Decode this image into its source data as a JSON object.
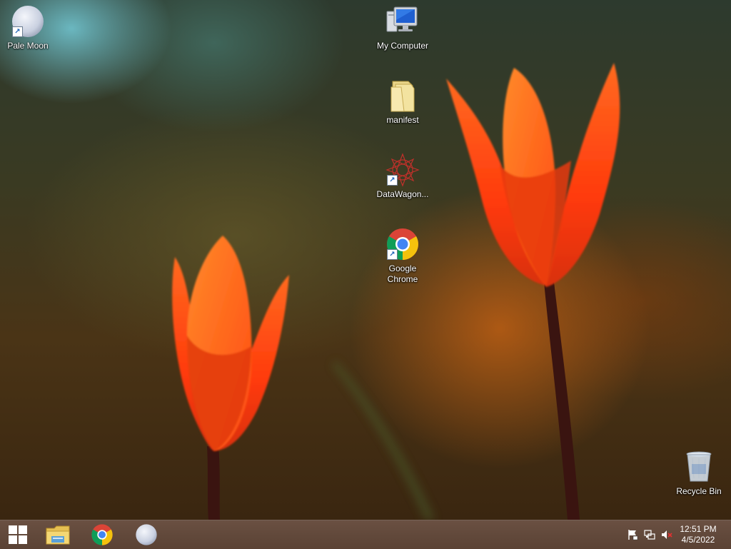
{
  "desktop": {
    "icons": {
      "pale_moon": {
        "label": "Pale Moon",
        "icon": "pale-moon-icon",
        "shortcut": true
      },
      "my_computer": {
        "label": "My Computer",
        "icon": "computer-icon",
        "shortcut": false
      },
      "manifest": {
        "label": "manifest",
        "icon": "folder-icon",
        "shortcut": false
      },
      "datawagon": {
        "label": "DataWagon...",
        "icon": "datawagon-icon",
        "shortcut": true
      },
      "google_chrome": {
        "label_line1": "Google",
        "label_line2": "Chrome",
        "icon": "chrome-icon",
        "shortcut": true
      },
      "recycle_bin": {
        "label": "Recycle Bin",
        "icon": "recycle-bin-icon",
        "shortcut": false
      }
    }
  },
  "taskbar": {
    "start": {
      "icon": "windows-logo-icon"
    },
    "pinned": [
      {
        "name": "File Explorer",
        "icon": "folder-icon"
      },
      {
        "name": "Google Chrome",
        "icon": "chrome-icon"
      },
      {
        "name": "Pale Moon",
        "icon": "pale-moon-icon"
      }
    ],
    "tray": {
      "icons": [
        "action-center-flag-icon",
        "network-icon",
        "volume-muted-icon"
      ],
      "time": "12:51 PM",
      "date": "4/5/2022"
    }
  },
  "colors": {
    "taskbar": "#5e4638",
    "tulip": "#ff4a10",
    "label_text": "#ffffff"
  }
}
